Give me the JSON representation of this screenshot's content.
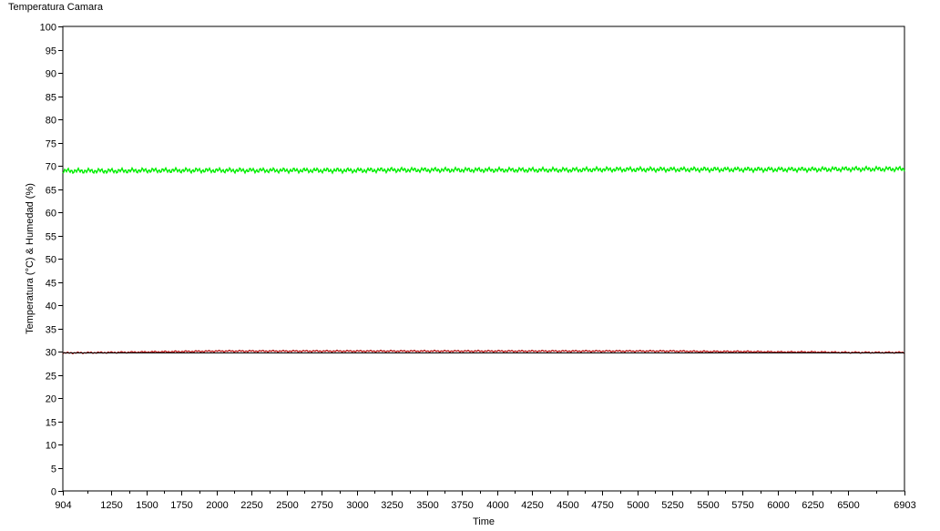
{
  "chart_data": {
    "type": "line",
    "title": "Temperatura Camara",
    "xlabel": "Time",
    "ylabel": "Temperatura (°C) & Humedad (%)",
    "xlim": [
      904,
      6903
    ],
    "ylim": [
      0,
      100
    ],
    "x_ticks": [
      904,
      1250,
      1500,
      1750,
      2000,
      2250,
      2500,
      2750,
      3000,
      3250,
      3500,
      3750,
      4000,
      4250,
      4500,
      4750,
      5000,
      5250,
      5500,
      5750,
      6000,
      6250,
      6500,
      6903
    ],
    "y_ticks": [
      0,
      5,
      10,
      15,
      20,
      25,
      30,
      35,
      40,
      45,
      50,
      55,
      60,
      65,
      70,
      75,
      80,
      85,
      90,
      95,
      100
    ],
    "grid": false,
    "legend": "none",
    "series": [
      {
        "color": "#00ee00",
        "x": [
          904,
          1250,
          1500,
          1750,
          2000,
          2250,
          2500,
          2750,
          3000,
          3250,
          3500,
          3750,
          4000,
          4250,
          4500,
          4750,
          5000,
          5250,
          5500,
          5750,
          6000,
          6250,
          6500,
          6903
        ],
        "values": [
          68.9,
          68.9,
          69.0,
          69.0,
          69.0,
          69.0,
          69.0,
          69.0,
          69.0,
          69.1,
          69.1,
          69.1,
          69.1,
          69.1,
          69.1,
          69.2,
          69.2,
          69.2,
          69.2,
          69.2,
          69.2,
          69.2,
          69.3,
          69.3
        ]
      },
      {
        "color": "#aa0000",
        "x": [
          904,
          1250,
          1500,
          1750,
          2000,
          2250,
          2500,
          2750,
          3000,
          3250,
          3500,
          3750,
          4000,
          4250,
          4500,
          4750,
          5000,
          5250,
          5500,
          5750,
          6000,
          6250,
          6500,
          6903
        ],
        "values": [
          29.7,
          29.8,
          29.9,
          30.0,
          30.1,
          30.1,
          30.1,
          30.1,
          30.1,
          30.1,
          30.1,
          30.1,
          30.1,
          30.1,
          30.1,
          30.1,
          30.1,
          30.1,
          30.0,
          30.0,
          29.9,
          29.9,
          29.8,
          29.8
        ]
      },
      {
        "color": "#000000",
        "x": [
          904,
          6903
        ],
        "values": [
          29.8,
          29.8
        ]
      }
    ]
  }
}
